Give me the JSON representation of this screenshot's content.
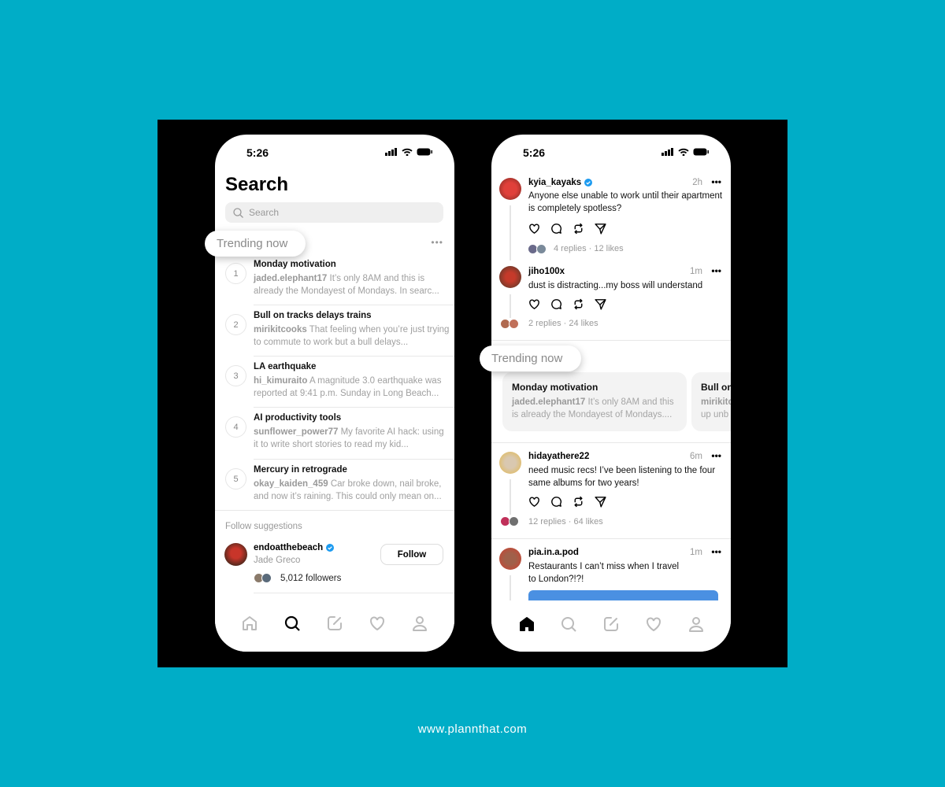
{
  "left_phone": {
    "time": "5:26",
    "title": "Search",
    "search_placeholder": "Search",
    "trending_label": "Trending now",
    "trends": [
      {
        "rank": "1",
        "title": "Monday motivation",
        "user": "jaded.elephant17",
        "text": "It’s only 8AM and this is already the Mondayest of Mondays. In searc..."
      },
      {
        "rank": "2",
        "title": "Bull on tracks delays trains",
        "user": "mirikitcooks",
        "text": "That feeling when you’re just trying to commute to work but a bull delays..."
      },
      {
        "rank": "3",
        "title": "LA earthquake",
        "user": "hi_kimuraito",
        "text": "A magnitude 3.0 earthquake was reported at 9:41 p.m. Sunday in Long Beach..."
      },
      {
        "rank": "4",
        "title": "AI productivity tools",
        "user": "sunflower_power77",
        "text": "My favorite AI hack: using it to write short stories to read my kid..."
      },
      {
        "rank": "5",
        "title": "Mercury in retrograde",
        "user": "okay_kaiden_459",
        "text": "Car broke down, nail broke, and now it’s raining. This could only mean on..."
      }
    ],
    "follow_heading": "Follow suggestions",
    "suggestion": {
      "username": "endoatthebeach",
      "name": "Jade Greco",
      "followers": "5,012 followers",
      "button": "Follow",
      "verified": true
    },
    "nav_active": "search"
  },
  "right_phone": {
    "time": "5:26",
    "posts": [
      {
        "user": "kyia_kayaks",
        "verified": true,
        "time": "2h",
        "text": "Anyone else unable to work until their apartment is completely spotless?",
        "stats": "4 replies · 12 likes"
      },
      {
        "user": "jiho100x",
        "time": "1m",
        "text": "dust is distracting...my boss will understand",
        "stats": "2 replies · 24 likes"
      },
      {
        "user": "hidayathere22",
        "time": "6m",
        "text": "need music recs! I’ve been listening to the four same albums for two years!",
        "stats": "12 replies · 64 likes"
      },
      {
        "user": "pia.in.a.pod",
        "time": "1m",
        "text": "Restaurants I can’t miss when I travel to London?!?!"
      }
    ],
    "trending_label": "Trending now",
    "cards": [
      {
        "title": "Monday motivation",
        "user": "jaded.elephant17",
        "text": "It’s only 8AM and this is already the Mondayest of Mondays...."
      },
      {
        "title": "Bull on tracks delays trains",
        "user": "mirikitcooks",
        "text": "up unb"
      }
    ],
    "nav_active": "home"
  },
  "footer": "www.plannthat.com",
  "colors": {
    "background": "#00adc7",
    "verified": "#1d9bf0",
    "image_placeholder": "#4a90e2"
  }
}
